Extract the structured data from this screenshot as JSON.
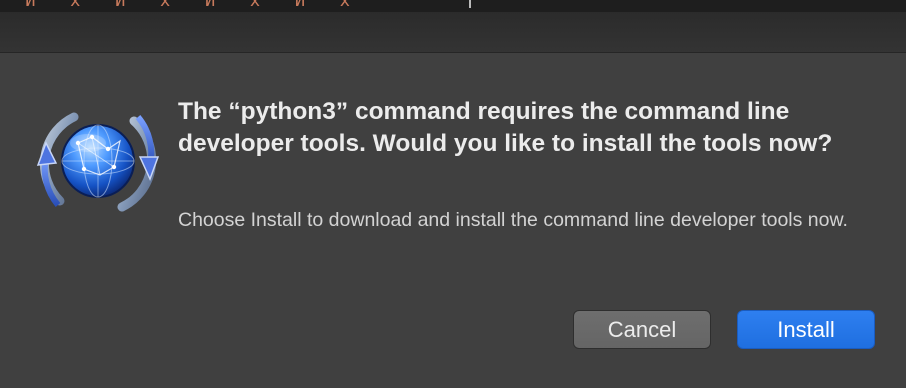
{
  "terminal": {
    "partial_text": "\"И\" \"x\" \"И\" \"x\" \"И\" \"x\" \"И\" \"x\""
  },
  "dialog": {
    "icon": "software-update-globe-icon",
    "title": "The “python3” command requires the command line developer tools. Would you like to install the tools now?",
    "message": "Choose Install to download and install the command line developer tools now.",
    "buttons": {
      "cancel_label": "Cancel",
      "install_label": "Install"
    }
  },
  "colors": {
    "dialog_background": "#404040",
    "accent": "#2a78ec",
    "terminal_text": "#c87a5c"
  }
}
